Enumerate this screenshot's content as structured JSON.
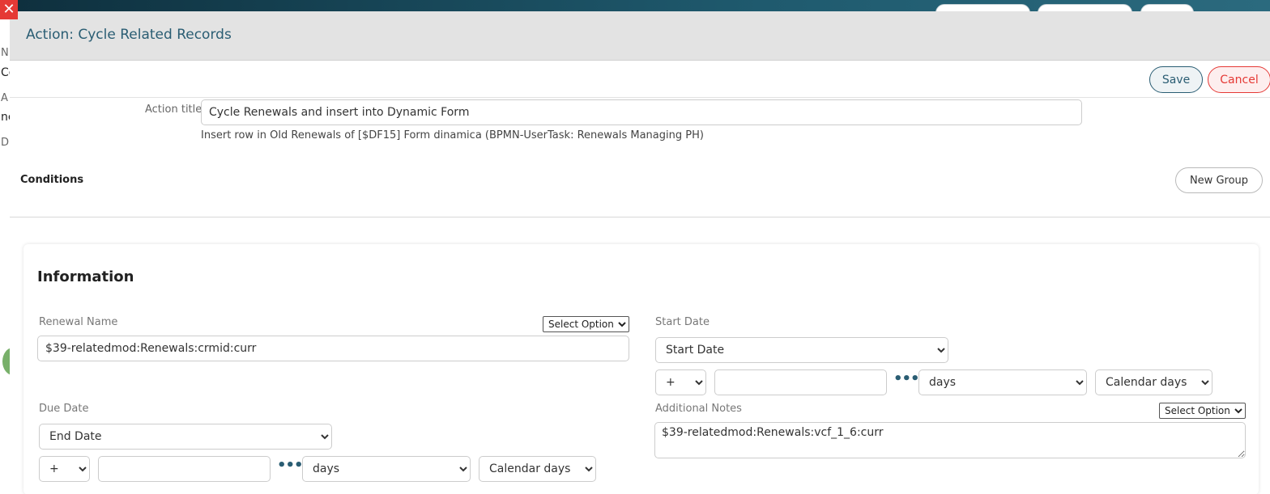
{
  "background": {
    "close_icon": "close-icon",
    "left_strip_letters": [
      "N",
      "Co",
      "A",
      "nc",
      "D"
    ]
  },
  "modal": {
    "title": "Action: Cycle Related Records",
    "save_label": "Save",
    "cancel_label": "Cancel"
  },
  "action_title": {
    "label": "Action title",
    "value": "Cycle Renewals and insert into Dynamic Form",
    "help": "Insert row in Old Renewals of [$DF15] Form dinamica (BPMN-UserTask: Renewals Managing PH)"
  },
  "conditions": {
    "label": "Conditions",
    "new_group_label": "New Group"
  },
  "information": {
    "title": "Information",
    "renewal_name": {
      "label": "Renewal Name",
      "value": "$39-relatedmod:Renewals:crmid:curr",
      "option_select": "Select Option..."
    },
    "start_date": {
      "label": "Start Date",
      "selected": "Start Date",
      "sign": "+",
      "offset_value": "",
      "unit": "days",
      "day_type": "Calendar days"
    },
    "due_date": {
      "label": "Due Date",
      "selected": "End Date",
      "sign": "+",
      "offset_value": "",
      "unit": "days",
      "day_type": "Calendar days"
    },
    "additional_notes": {
      "label": "Additional Notes",
      "value": "$39-relatedmod:Renewals:vcf_1_6:curr",
      "option_select": "Select Option..."
    },
    "more_icon": "more-horizontal-icon"
  },
  "colors": {
    "accent": "#2a5d73",
    "danger": "#e53935",
    "header_bg": "#e3e3e3"
  }
}
